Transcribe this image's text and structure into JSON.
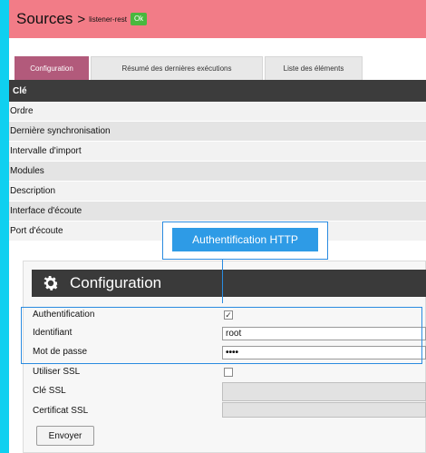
{
  "header": {
    "title": "Sources",
    "separator": ">",
    "source_name": "listener-rest",
    "status_badge": "Ok"
  },
  "tabs": [
    {
      "label": "Configuration",
      "active": true
    },
    {
      "label": "Résumé des dernières exécutions",
      "active": false
    },
    {
      "label": "Liste des éléments",
      "active": false
    }
  ],
  "table": {
    "column_header": "Clé",
    "rows": [
      "Ordre",
      "Dernière synchronisation",
      "Intervalle d'import",
      "Modules",
      "Description",
      "Interface d'écoute",
      "Port d'écoute"
    ]
  },
  "callout": {
    "label": "Authentification HTTP"
  },
  "modal": {
    "title": "Configuration",
    "icon": "gear-icon",
    "fields": {
      "authentication": {
        "label": "Authentification",
        "checked": true
      },
      "identifier": {
        "label": "Identifiant",
        "value": "root"
      },
      "password": {
        "label": "Mot de passe",
        "value": "••••"
      },
      "use_ssl": {
        "label": "Utiliser SSL",
        "checked": false
      },
      "ssl_key": {
        "label": "Clé SSL",
        "value": ""
      },
      "ssl_cert": {
        "label": "Certificat SSL",
        "value": ""
      }
    },
    "submit_label": "Envoyer"
  },
  "colors": {
    "header_bg": "#f27c87",
    "badge_bg": "#49b83e",
    "active_tab": "#b25a7b",
    "left_strip": "#0fd0f0",
    "callout_blue": "#2e9be6"
  }
}
